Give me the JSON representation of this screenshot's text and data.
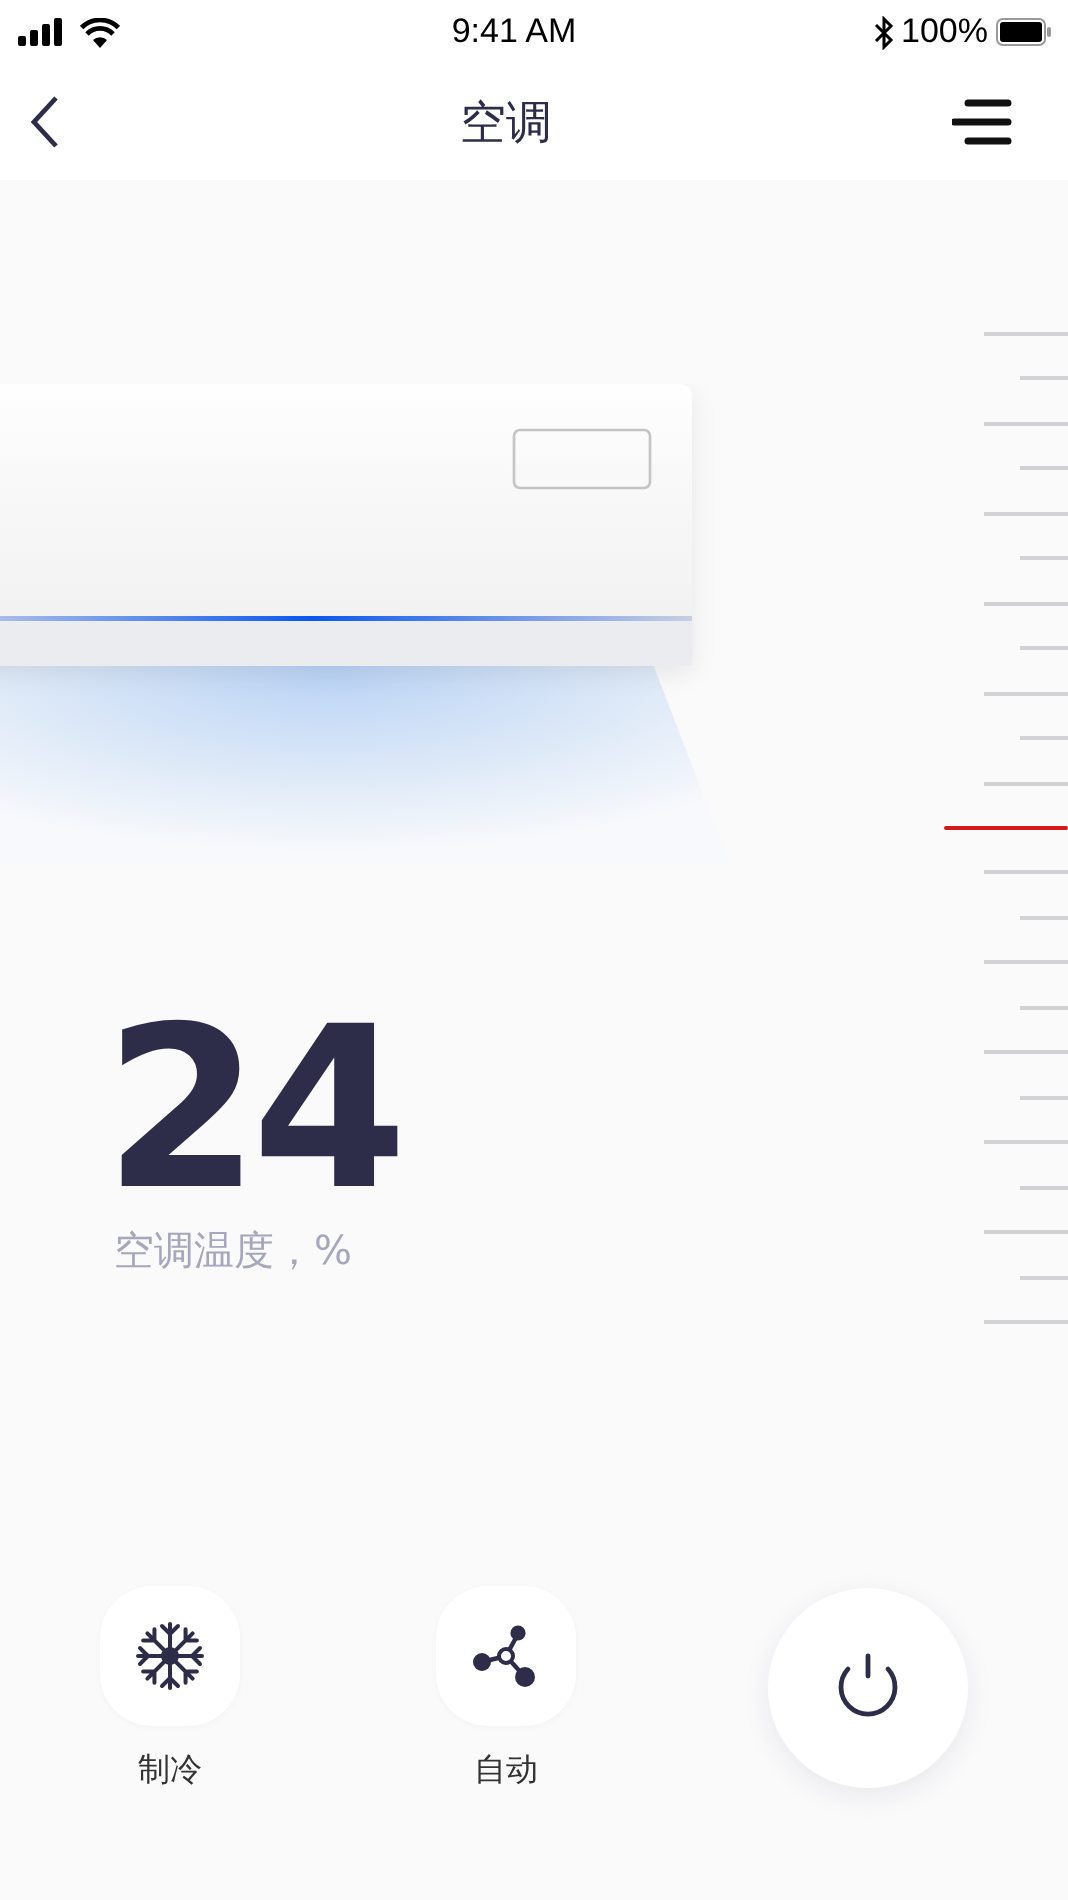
{
  "status_bar": {
    "time": "9:41 AM",
    "battery": "100%"
  },
  "nav_bar": {
    "title": "空调"
  },
  "temperature": {
    "value": "24",
    "label": "空调温度，%"
  },
  "scale": {
    "level": 0.5
  },
  "modes": [
    {
      "kind": "cool",
      "label": "制冷"
    },
    {
      "kind": "auto",
      "label": "自动"
    }
  ]
}
